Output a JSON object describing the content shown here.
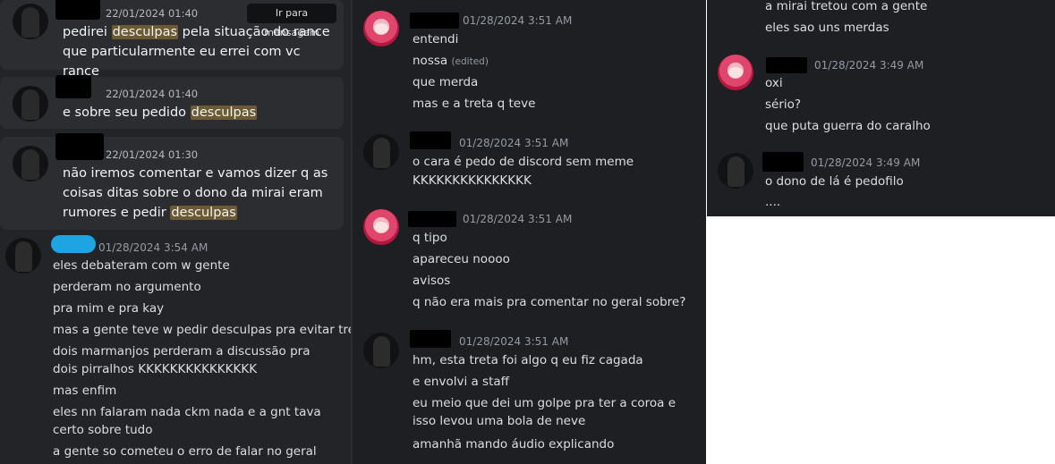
{
  "left_panel": {
    "jump_label": "Ir para mensagem",
    "results": [
      {
        "time": "22/01/2024 01:40",
        "segments": [
          {
            "text": "pedirei "
          },
          {
            "text": "desculpas",
            "hl": true
          },
          {
            "text": " pela situação do rance que particularmente eu errei com vc rance"
          }
        ]
      },
      {
        "time": "22/01/2024 01:40",
        "segments": [
          {
            "text": "e sobre seu pedido "
          },
          {
            "text": "desculpas",
            "hl": true
          }
        ]
      },
      {
        "time": "22/01/2024 01:30",
        "segments": [
          {
            "text": "não iremos comentar e vamos dizer q as coisas ditas sobre o dono da mirai eram rumores e pedir "
          },
          {
            "text": "desculpas",
            "hl": true
          }
        ]
      }
    ],
    "chat": {
      "time": "01/28/2024 3:54 AM",
      "lines": [
        "eles debateram com w gente",
        "perderam no argumento",
        "pra mim e pra kay",
        "mas a gente teve w pedir desculpas pra evitar treta",
        "dois marmanjos perderam a discussão pra dois pirralhos KKKKKKKKKKKKKKK",
        "mas enfim",
        "eles nn falaram nada ckm nada e a gnt tava certo sobre tudo",
        "a gente so cometeu o erro de falar no geral"
      ]
    }
  },
  "mid_panel": {
    "groups": [
      {
        "time": "01/28/2024 3:51 AM",
        "lines": [
          "entendi",
          "nossa",
          "que merda",
          "mas e a treta q teve"
        ],
        "edited_label": "(edited)"
      },
      {
        "time": "01/28/2024 3:51 AM",
        "lines": [
          "o cara é pedo de discord sem meme",
          "KKKKKKKKKKKKKKK"
        ]
      },
      {
        "time": "01/28/2024 3:51 AM",
        "lines": [
          "q tipo",
          "apareceu noooo",
          "avisos",
          "q não era mais pra comentar no geral sobre?"
        ]
      },
      {
        "time": "01/28/2024 3:51 AM",
        "lines": [
          "hm, esta treta foi algo q eu fiz cagada",
          "e envolvi a staff",
          "eu meio que dei um golpe pra ter a coroa e isso levou uma bola de neve",
          "amanhã mando áudio explicando"
        ]
      }
    ]
  },
  "right_panel": {
    "top_lines": [
      "a mirai tretou com a gente",
      "eles sao uns merdas"
    ],
    "groups": [
      {
        "time": "01/28/2024 3:49 AM",
        "lines": [
          "oxi",
          "sério?",
          "que puta guerra do caralho"
        ]
      },
      {
        "time": "01/28/2024 3:49 AM",
        "lines": [
          "o dono de lá é pedofilo",
          "...."
        ]
      }
    ]
  },
  "colors": {
    "highlight": "#6b5a33",
    "card_bg": "#2b2d31",
    "chat_bg": "#1e1f22",
    "username_blue": "#1ea4e0"
  }
}
